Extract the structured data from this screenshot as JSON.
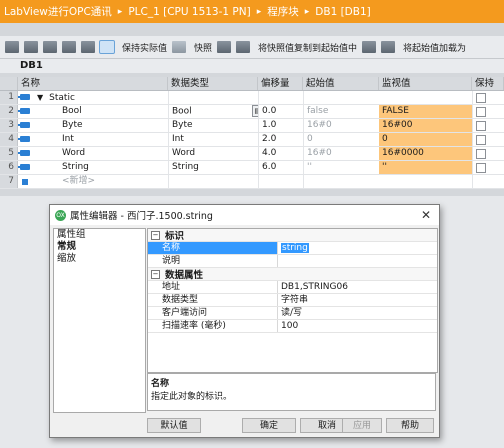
{
  "titlebar": {
    "crumbs": [
      "LabView进行OPC通讯",
      "PLC_1 [CPU 1513-1 PN]",
      "程序块",
      "DB1 [DB1]"
    ],
    "separator": "▸"
  },
  "toolbar": {
    "keep_actual_label": "保持实际值",
    "snapshot_label": "快照",
    "copy_snapshot_label": "将快照值复制到起始值中",
    "load_start_label": "将起始值加载为"
  },
  "block": {
    "name": "DB1"
  },
  "table": {
    "headers": [
      "名称",
      "数据类型",
      "偏移量",
      "起始值",
      "监视值",
      "保持"
    ],
    "rows": [
      {
        "num": "1",
        "name": "Static",
        "type": "",
        "offset": "",
        "start": "",
        "monitor": "",
        "group": true
      },
      {
        "num": "2",
        "name": "Bool",
        "type": "Bool",
        "offset": "0.0",
        "start": "false",
        "monitor": "FALSE"
      },
      {
        "num": "3",
        "name": "Byte",
        "type": "Byte",
        "offset": "1.0",
        "start": "16#0",
        "monitor": "16#00"
      },
      {
        "num": "4",
        "name": "Int",
        "type": "Int",
        "offset": "2.0",
        "start": "0",
        "monitor": "0"
      },
      {
        "num": "5",
        "name": "Word",
        "type": "Word",
        "offset": "4.0",
        "start": "16#0",
        "monitor": "16#0000"
      },
      {
        "num": "6",
        "name": "String",
        "type": "String",
        "offset": "6.0",
        "start": "''",
        "monitor": "''"
      },
      {
        "num": "7",
        "name": "<新增>",
        "type": "",
        "offset": "",
        "start": "",
        "monitor": ""
      }
    ]
  },
  "dialog": {
    "logo_text": "OX",
    "title": "属性编辑器 - 西门子.1500.string",
    "close": "✕",
    "left_items": [
      "属性组",
      "常规",
      "缩放"
    ],
    "categories": {
      "identification": "标识",
      "data_properties": "数据属性"
    },
    "toggle": "−",
    "props": {
      "name": {
        "key": "名称",
        "value": "string"
      },
      "desc": {
        "key": "说明",
        "value": ""
      },
      "address": {
        "key": "地址",
        "value": "DB1,STRING06"
      },
      "datatype": {
        "key": "数据类型",
        "value": "字符串"
      },
      "client_access": {
        "key": "客户端访问",
        "value": "读/写"
      },
      "scan_rate": {
        "key": "扫描速率 (毫秒)",
        "value": "100"
      }
    },
    "description": {
      "title": "名称",
      "text": "指定此对象的标识。"
    },
    "buttons": {
      "default": "默认值",
      "ok": "确定",
      "cancel": "取消",
      "apply": "应用",
      "help": "帮助"
    }
  }
}
